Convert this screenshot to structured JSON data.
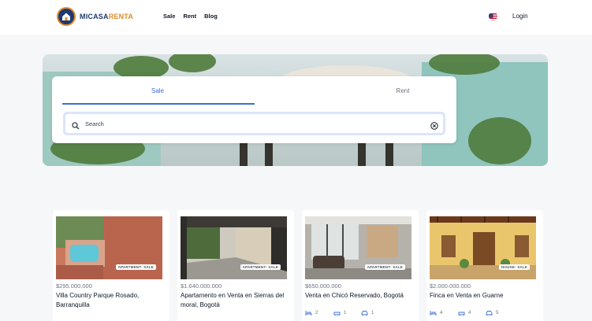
{
  "header": {
    "logo": {
      "part1": "MICASA",
      "part2": "RENTA"
    },
    "nav": [
      "Sale",
      "Rent",
      "Blog"
    ],
    "login": "Login",
    "language_icon": "us-flag-icon"
  },
  "search": {
    "tabs": {
      "sale": "Sale",
      "rent": "Rent"
    },
    "active_tab": "Sale",
    "placeholder": "Search",
    "value": ""
  },
  "colors": {
    "accent": "#3b6fd6",
    "brand_orange": "#e08a2c",
    "brand_navy": "#1e3a6e"
  },
  "listings": [
    {
      "badge": "APARTMENT- SALE",
      "price": "$295.000.000",
      "name": "Villa Country Parque Rosado, Barranquilla",
      "beds": "",
      "baths": "",
      "garages": ""
    },
    {
      "badge": "APARTMENT- SALE",
      "price": "$1.640.000.000",
      "name": "Apartamento en Venta en Sierras del moral, Bogotá",
      "beds": "",
      "baths": "",
      "garages": ""
    },
    {
      "badge": "APARTMENT- SALE",
      "price": "$650.000.000",
      "name": "Venta en Chicó Reservado, Bogotá",
      "beds": "2",
      "baths": "1",
      "garages": "1"
    },
    {
      "badge": "HOUSE- SALE",
      "price": "$2.000.000.000",
      "name": "Finca en Venta en Guarne",
      "beds": "4",
      "baths": "4",
      "garages": "5"
    }
  ]
}
